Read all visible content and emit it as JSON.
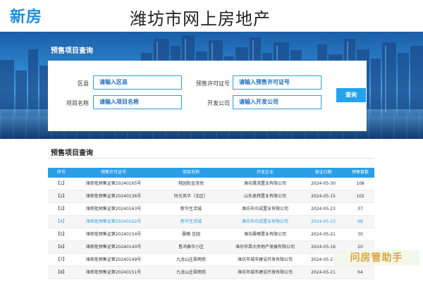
{
  "header": {
    "logo_text": "新房",
    "site_title": "潍坊市网上房地产"
  },
  "banner": {
    "title": "预售项目查询"
  },
  "search": {
    "district_label": "区县",
    "district_placeholder": "请输入区县",
    "permit_label": "预售许可证号",
    "permit_placeholder": "请输入预售许可证号",
    "project_label": "项目名称",
    "project_placeholder": "请输入项目名称",
    "developer_label": "开发公司",
    "developer_placeholder": "请输入开发公司",
    "button_label": "查询"
  },
  "section": {
    "title": "预售项目查询"
  },
  "table": {
    "headers": [
      "序号",
      "预售许可证号",
      "项目名称",
      "开发企业",
      "发证日期",
      "预售套数"
    ],
    "rows": [
      [
        "【1】",
        "潍审批预售证第20240165号",
        "桃园街金茂悦",
        "潍坊晟茂置业有限公司",
        "2024-05-30",
        "108"
      ],
      [
        "【2】",
        "潍审批预售证第20240136号",
        "时光风华（北区）",
        "山东泉辉置业有限公司",
        "2024-05-15",
        "102"
      ],
      [
        "【3】",
        "潍审批预售证第20240163号",
        "新华生活城",
        "潍坊市众成置业有限公司",
        "2024-05-23",
        "37"
      ],
      [
        "【4】",
        "潍审批预售证第20240162号",
        "新华生活城",
        "潍坊市众成置业有限公司",
        "2024-05-23",
        "68"
      ],
      [
        "【5】",
        "潍审批预售证第20240154号",
        "晨曦·佳园",
        "潍坊晨曦置业有限公司",
        "2024-05-21",
        "30"
      ],
      [
        "【6】",
        "潍审批预售证第20240140号",
        "鲁鸿泰华小区",
        "潍坊市昌大房地产发展有限公司",
        "2024-05-16",
        "20"
      ],
      [
        "【7】",
        "潍审批预售证第20240149号",
        "九龙山庄翠雨苑",
        "潍坊市城市建设开发有限公司",
        "2024-05-21",
        "30"
      ],
      [
        "【8】",
        "潍审批预售证第20240151号",
        "九龙山庄翠雨苑",
        "潍坊市城市建设开发有限公司",
        "2024-05-21",
        "64"
      ]
    ]
  },
  "watermark": {
    "text": "问房管助手"
  },
  "colors": {
    "accent": "#2b9fe6",
    "logo": "#1f8fd9"
  }
}
